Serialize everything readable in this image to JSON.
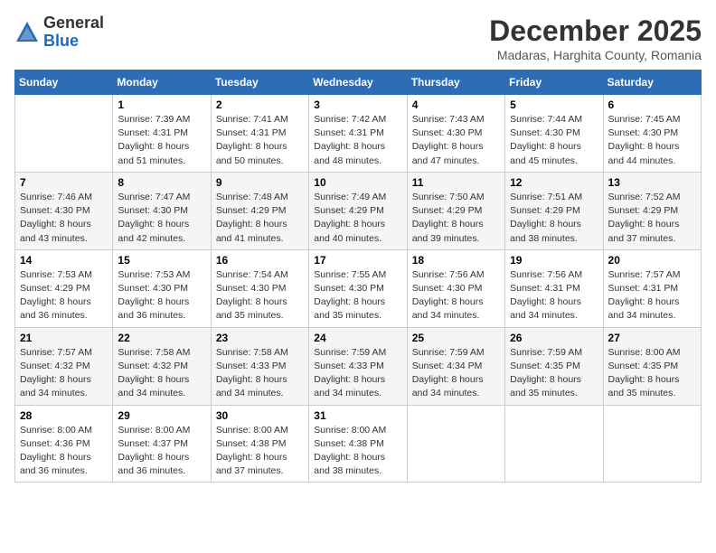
{
  "header": {
    "logo_general": "General",
    "logo_blue": "Blue",
    "month_title": "December 2025",
    "location": "Madaras, Harghita County, Romania"
  },
  "weekdays": [
    "Sunday",
    "Monday",
    "Tuesday",
    "Wednesday",
    "Thursday",
    "Friday",
    "Saturday"
  ],
  "weeks": [
    [
      {
        "day": "",
        "sunrise": "",
        "sunset": "",
        "daylight": ""
      },
      {
        "day": "1",
        "sunrise": "Sunrise: 7:39 AM",
        "sunset": "Sunset: 4:31 PM",
        "daylight": "Daylight: 8 hours and 51 minutes."
      },
      {
        "day": "2",
        "sunrise": "Sunrise: 7:41 AM",
        "sunset": "Sunset: 4:31 PM",
        "daylight": "Daylight: 8 hours and 50 minutes."
      },
      {
        "day": "3",
        "sunrise": "Sunrise: 7:42 AM",
        "sunset": "Sunset: 4:31 PM",
        "daylight": "Daylight: 8 hours and 48 minutes."
      },
      {
        "day": "4",
        "sunrise": "Sunrise: 7:43 AM",
        "sunset": "Sunset: 4:30 PM",
        "daylight": "Daylight: 8 hours and 47 minutes."
      },
      {
        "day": "5",
        "sunrise": "Sunrise: 7:44 AM",
        "sunset": "Sunset: 4:30 PM",
        "daylight": "Daylight: 8 hours and 45 minutes."
      },
      {
        "day": "6",
        "sunrise": "Sunrise: 7:45 AM",
        "sunset": "Sunset: 4:30 PM",
        "daylight": "Daylight: 8 hours and 44 minutes."
      }
    ],
    [
      {
        "day": "7",
        "sunrise": "Sunrise: 7:46 AM",
        "sunset": "Sunset: 4:30 PM",
        "daylight": "Daylight: 8 hours and 43 minutes."
      },
      {
        "day": "8",
        "sunrise": "Sunrise: 7:47 AM",
        "sunset": "Sunset: 4:30 PM",
        "daylight": "Daylight: 8 hours and 42 minutes."
      },
      {
        "day": "9",
        "sunrise": "Sunrise: 7:48 AM",
        "sunset": "Sunset: 4:29 PM",
        "daylight": "Daylight: 8 hours and 41 minutes."
      },
      {
        "day": "10",
        "sunrise": "Sunrise: 7:49 AM",
        "sunset": "Sunset: 4:29 PM",
        "daylight": "Daylight: 8 hours and 40 minutes."
      },
      {
        "day": "11",
        "sunrise": "Sunrise: 7:50 AM",
        "sunset": "Sunset: 4:29 PM",
        "daylight": "Daylight: 8 hours and 39 minutes."
      },
      {
        "day": "12",
        "sunrise": "Sunrise: 7:51 AM",
        "sunset": "Sunset: 4:29 PM",
        "daylight": "Daylight: 8 hours and 38 minutes."
      },
      {
        "day": "13",
        "sunrise": "Sunrise: 7:52 AM",
        "sunset": "Sunset: 4:29 PM",
        "daylight": "Daylight: 8 hours and 37 minutes."
      }
    ],
    [
      {
        "day": "14",
        "sunrise": "Sunrise: 7:53 AM",
        "sunset": "Sunset: 4:29 PM",
        "daylight": "Daylight: 8 hours and 36 minutes."
      },
      {
        "day": "15",
        "sunrise": "Sunrise: 7:53 AM",
        "sunset": "Sunset: 4:30 PM",
        "daylight": "Daylight: 8 hours and 36 minutes."
      },
      {
        "day": "16",
        "sunrise": "Sunrise: 7:54 AM",
        "sunset": "Sunset: 4:30 PM",
        "daylight": "Daylight: 8 hours and 35 minutes."
      },
      {
        "day": "17",
        "sunrise": "Sunrise: 7:55 AM",
        "sunset": "Sunset: 4:30 PM",
        "daylight": "Daylight: 8 hours and 35 minutes."
      },
      {
        "day": "18",
        "sunrise": "Sunrise: 7:56 AM",
        "sunset": "Sunset: 4:30 PM",
        "daylight": "Daylight: 8 hours and 34 minutes."
      },
      {
        "day": "19",
        "sunrise": "Sunrise: 7:56 AM",
        "sunset": "Sunset: 4:31 PM",
        "daylight": "Daylight: 8 hours and 34 minutes."
      },
      {
        "day": "20",
        "sunrise": "Sunrise: 7:57 AM",
        "sunset": "Sunset: 4:31 PM",
        "daylight": "Daylight: 8 hours and 34 minutes."
      }
    ],
    [
      {
        "day": "21",
        "sunrise": "Sunrise: 7:57 AM",
        "sunset": "Sunset: 4:32 PM",
        "daylight": "Daylight: 8 hours and 34 minutes."
      },
      {
        "day": "22",
        "sunrise": "Sunrise: 7:58 AM",
        "sunset": "Sunset: 4:32 PM",
        "daylight": "Daylight: 8 hours and 34 minutes."
      },
      {
        "day": "23",
        "sunrise": "Sunrise: 7:58 AM",
        "sunset": "Sunset: 4:33 PM",
        "daylight": "Daylight: 8 hours and 34 minutes."
      },
      {
        "day": "24",
        "sunrise": "Sunrise: 7:59 AM",
        "sunset": "Sunset: 4:33 PM",
        "daylight": "Daylight: 8 hours and 34 minutes."
      },
      {
        "day": "25",
        "sunrise": "Sunrise: 7:59 AM",
        "sunset": "Sunset: 4:34 PM",
        "daylight": "Daylight: 8 hours and 34 minutes."
      },
      {
        "day": "26",
        "sunrise": "Sunrise: 7:59 AM",
        "sunset": "Sunset: 4:35 PM",
        "daylight": "Daylight: 8 hours and 35 minutes."
      },
      {
        "day": "27",
        "sunrise": "Sunrise: 8:00 AM",
        "sunset": "Sunset: 4:35 PM",
        "daylight": "Daylight: 8 hours and 35 minutes."
      }
    ],
    [
      {
        "day": "28",
        "sunrise": "Sunrise: 8:00 AM",
        "sunset": "Sunset: 4:36 PM",
        "daylight": "Daylight: 8 hours and 36 minutes."
      },
      {
        "day": "29",
        "sunrise": "Sunrise: 8:00 AM",
        "sunset": "Sunset: 4:37 PM",
        "daylight": "Daylight: 8 hours and 36 minutes."
      },
      {
        "day": "30",
        "sunrise": "Sunrise: 8:00 AM",
        "sunset": "Sunset: 4:38 PM",
        "daylight": "Daylight: 8 hours and 37 minutes."
      },
      {
        "day": "31",
        "sunrise": "Sunrise: 8:00 AM",
        "sunset": "Sunset: 4:38 PM",
        "daylight": "Daylight: 8 hours and 38 minutes."
      },
      {
        "day": "",
        "sunrise": "",
        "sunset": "",
        "daylight": ""
      },
      {
        "day": "",
        "sunrise": "",
        "sunset": "",
        "daylight": ""
      },
      {
        "day": "",
        "sunrise": "",
        "sunset": "",
        "daylight": ""
      }
    ]
  ]
}
